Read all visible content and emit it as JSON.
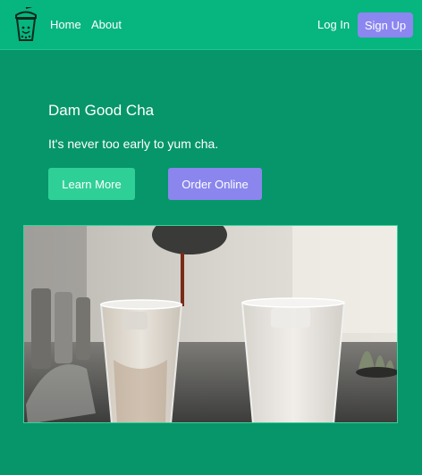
{
  "nav": {
    "logo": "boba-cup-logo",
    "links": [
      "Home",
      "About"
    ],
    "login_label": "Log In",
    "signup_label": "Sign Up"
  },
  "hero": {
    "title": "Dam Good Cha",
    "subtitle": "It's never too early to yum cha.",
    "learn_more_label": "Learn More",
    "order_online_label": "Order Online"
  },
  "image": {
    "subject": "two iced milk tea drinks being poured"
  },
  "colors": {
    "page_bg": "#079669",
    "navbar_bg": "#07b57f",
    "primary_button": "#2fd097",
    "accent_button": "#8a86ee"
  }
}
